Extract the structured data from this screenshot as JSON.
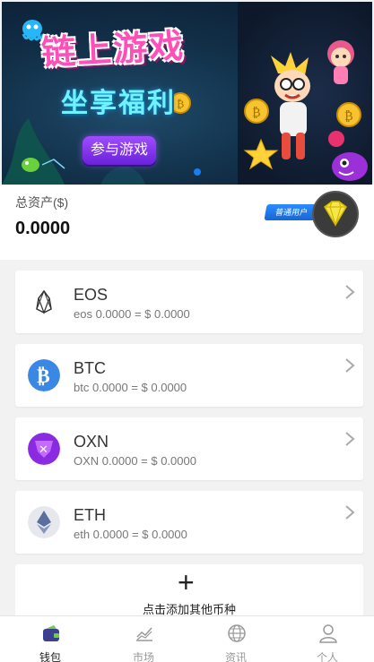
{
  "banner": {
    "title": "链上游戏",
    "subtitle": "坐享福利",
    "button_label": "参与游戏"
  },
  "assets": {
    "label": "总资产($)",
    "value": "0.0000",
    "user_badge": "普通用户"
  },
  "coins": [
    {
      "name": "EOS",
      "balance": "eos 0.0000 = $ 0.0000",
      "icon": "eos-icon",
      "color": "#ffffff"
    },
    {
      "name": "BTC",
      "balance": "btc 0.0000 = $ 0.0000",
      "icon": "btc-icon",
      "color": "#3b87e4"
    },
    {
      "name": "OXN",
      "balance": "OXN 0.0000 = $ 0.0000",
      "icon": "oxn-icon",
      "color": "#8a2be2"
    },
    {
      "name": "ETH",
      "balance": "eth 0.0000 = $ 0.0000",
      "icon": "eth-icon",
      "color": "#e6e8ee"
    }
  ],
  "add_coin": {
    "label": "点击添加其他币种"
  },
  "tabs": [
    {
      "label": "钱包",
      "icon": "wallet-icon",
      "active": true
    },
    {
      "label": "市场",
      "icon": "market-chart-icon",
      "active": false
    },
    {
      "label": "资讯",
      "icon": "globe-icon",
      "active": false
    },
    {
      "label": "个人",
      "icon": "person-icon",
      "active": false
    }
  ],
  "colors": {
    "accent_blue": "#1e7cf2",
    "banner_button": "#7b35e8"
  }
}
